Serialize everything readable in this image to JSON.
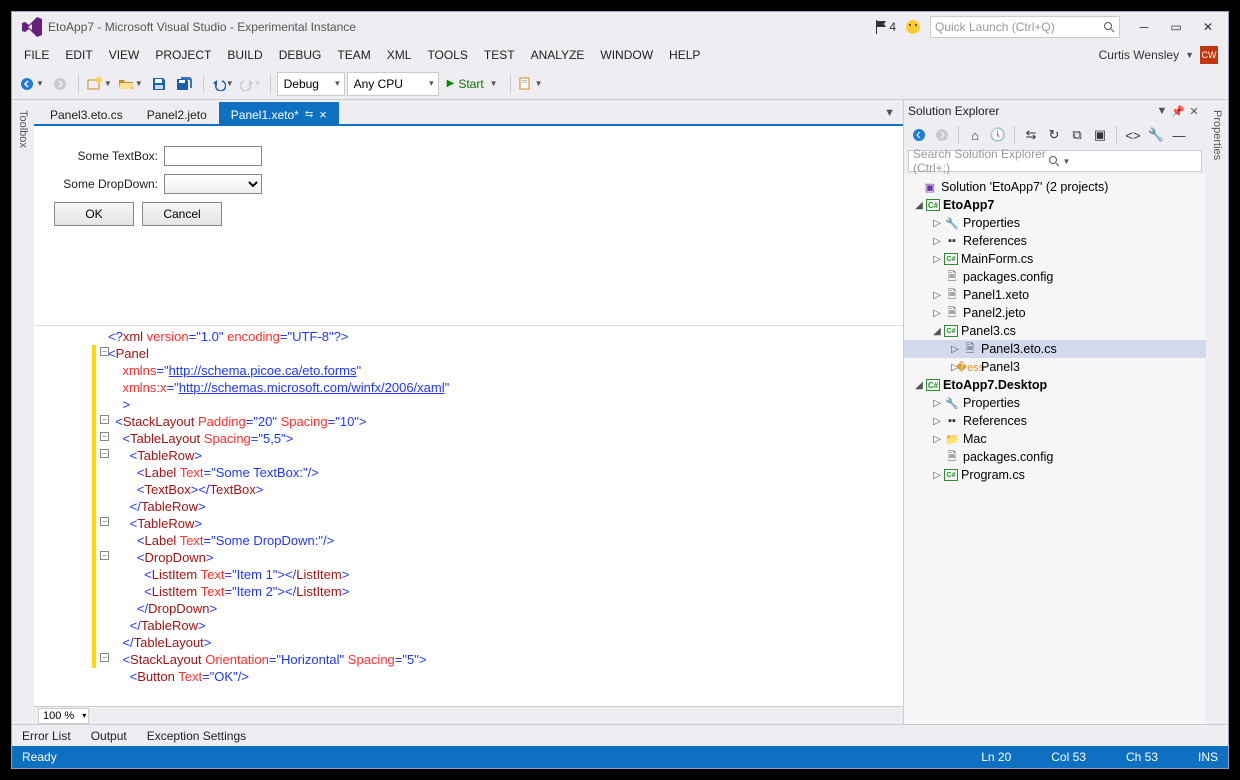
{
  "title": "EtoApp7 - Microsoft Visual Studio - Experimental Instance",
  "flag_count": "4",
  "quick_launch_placeholder": "Quick Launch (Ctrl+Q)",
  "user_name": "Curtis Wensley",
  "user_initials": "CW",
  "menu": [
    "FILE",
    "EDIT",
    "VIEW",
    "PROJECT",
    "BUILD",
    "DEBUG",
    "TEAM",
    "XML",
    "TOOLS",
    "TEST",
    "ANALYZE",
    "WINDOW",
    "HELP"
  ],
  "toolbar": {
    "config": "Debug",
    "platform": "Any CPU",
    "start": "Start"
  },
  "side_tabs": {
    "left": "Toolbox",
    "right": "Properties"
  },
  "doc_tabs": [
    {
      "label": "Panel3.eto.cs",
      "active": false
    },
    {
      "label": "Panel2.jeto",
      "active": false
    },
    {
      "label": "Panel1.xeto*",
      "active": true
    }
  ],
  "designer": {
    "row1_label": "Some TextBox:",
    "row2_label": "Some DropDown:",
    "ok": "OK",
    "cancel": "Cancel"
  },
  "zoom": "100 %",
  "solution_explorer": {
    "title": "Solution Explorer",
    "search_placeholder": "Search Solution Explorer (Ctrl+;)",
    "root": "Solution 'EtoApp7' (2 projects)",
    "proj1": "EtoApp7",
    "proj1_items": {
      "properties": "Properties",
      "references": "References",
      "mainform": "MainForm.cs",
      "packages": "packages.config",
      "panel1": "Panel1.xeto",
      "panel2": "Panel2.jeto",
      "panel3cs": "Panel3.cs",
      "panel3eto": "Panel3.eto.cs",
      "panel3cls": "Panel3"
    },
    "proj2": "EtoApp7.Desktop",
    "proj2_items": {
      "properties": "Properties",
      "references": "References",
      "mac": "Mac",
      "packages": "packages.config",
      "program": "Program.cs"
    }
  },
  "bottom_tabs": [
    "Error List",
    "Output",
    "Exception Settings"
  ],
  "status": {
    "ready": "Ready",
    "ln": "Ln 20",
    "col": "Col 53",
    "ch": "Ch 53",
    "ins": "INS"
  },
  "code": {
    "l1": "<?xml version=\"1.0\" encoding=\"UTF-8\"?>",
    "panel": "Panel",
    "xmlns_attr": "xmlns",
    "xmlns_val": "http://schema.picoe.ca/eto.forms",
    "xmlnsx_attr": "xmlns:x",
    "xmlnsx_val": "http://schemas.microsoft.com/winfx/2006/xaml",
    "stack": "StackLayout",
    "padding": "Padding",
    "padding_v": "20",
    "spacing": "Spacing",
    "spacing_v": "10",
    "table": "TableLayout",
    "tspacing_v": "5,5",
    "row": "TableRow",
    "label": "Label",
    "text": "Text",
    "text_tb": "Some TextBox:",
    "textbox": "TextBox",
    "text_dd": "Some DropDown:",
    "dropdown": "DropDown",
    "listitem": "ListItem",
    "item1": "Item 1",
    "item2": "Item 2",
    "orient": "Orientation",
    "horiz": "Horizontal",
    "sp5": "5",
    "button": "Button",
    "ok": "OK"
  }
}
